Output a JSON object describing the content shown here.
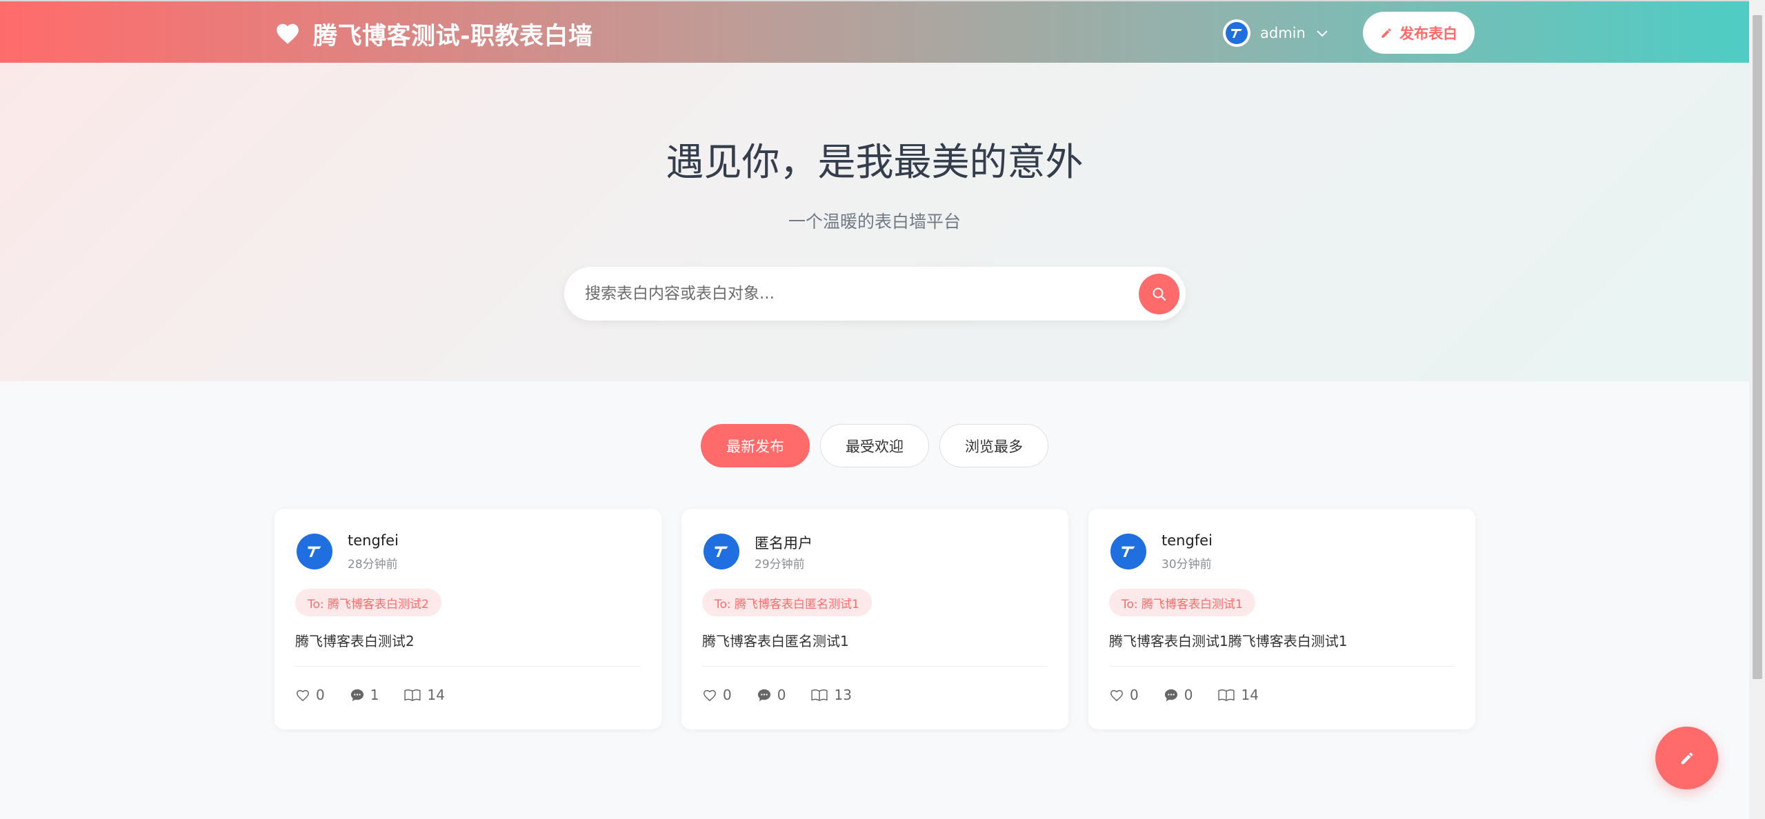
{
  "header": {
    "brand_title": "腾飞博客测试-职教表白墙",
    "username": "admin",
    "publish_label": "发布表白"
  },
  "hero": {
    "title": "遇见你，是我最美的意外",
    "subtitle": "一个温暖的表白墙平台",
    "search_placeholder": "搜索表白内容或表白对象..."
  },
  "tabs": [
    {
      "label": "最新发布",
      "active": true
    },
    {
      "label": "最受欢迎",
      "active": false
    },
    {
      "label": "浏览最多",
      "active": false
    }
  ],
  "cards": [
    {
      "author": "tengfei",
      "time": "28分钟前",
      "to": "To: 腾飞博客表白测试2",
      "body": "腾飞博客表白测试2",
      "likes": "0",
      "comments": "1",
      "views": "14"
    },
    {
      "author": "匿名用户",
      "time": "29分钟前",
      "to": "To: 腾飞博客表白匿名测试1",
      "body": "腾飞博客表白匿名测试1",
      "likes": "0",
      "comments": "0",
      "views": "13"
    },
    {
      "author": "tengfei",
      "time": "30分钟前",
      "to": "To: 腾飞博客表白测试1",
      "body": "腾飞博客表白测试1腾飞博客表白测试1",
      "likes": "0",
      "comments": "0",
      "views": "14"
    }
  ],
  "icons": {
    "brand": "heart-icon",
    "user_menu": "chevron-down-icon",
    "publish": "pencil-icon",
    "search": "search-icon",
    "like": "heart-outline-icon",
    "comment": "comment-icon",
    "view": "book-icon",
    "fab": "pencil-icon"
  },
  "colors": {
    "accent": "#ff6b6b",
    "accent_soft": "#fde9e9",
    "teal": "#4ecdc4",
    "avatar_blue": "#1f6fe0"
  }
}
